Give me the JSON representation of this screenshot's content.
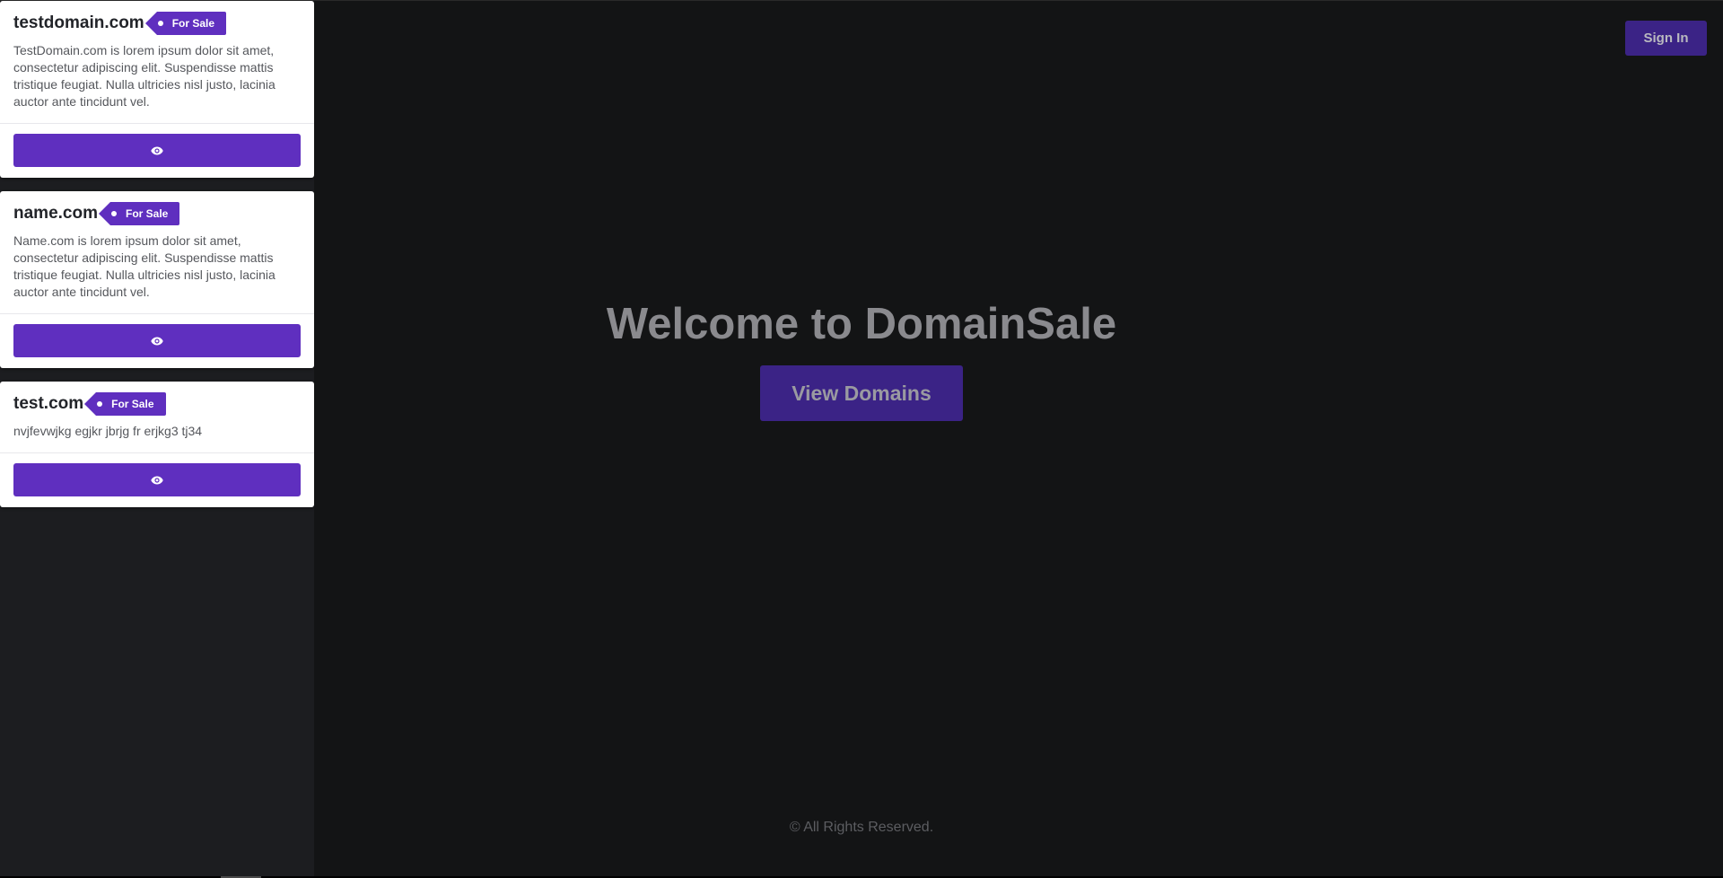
{
  "domains": [
    {
      "name": "testdomain.com",
      "tag": "For Sale",
      "description": "TestDomain.com is lorem ipsum dolor sit amet, consectetur adipiscing elit. Suspendisse mattis tristique feugiat. Nulla ultricies nisl justo, lacinia auctor ante tincidunt vel."
    },
    {
      "name": "name.com",
      "tag": "For Sale",
      "description": "Name.com is lorem ipsum dolor sit amet, consectetur adipiscing elit. Suspendisse mattis tristique feugiat. Nulla ultricies nisl justo, lacinia auctor ante tincidunt vel."
    },
    {
      "name": "test.com",
      "tag": "For Sale",
      "description": "nvjfevwjkg egjkr jbrjg fr erjkg3 tj34"
    }
  ],
  "card_button_icon": "eye-icon",
  "header": {
    "signin_label": "Sign In"
  },
  "hero": {
    "title": "Welcome to DomainSale",
    "button_label": "View Domains"
  },
  "footer": {
    "text": "© All Rights Reserved."
  },
  "colors": {
    "accent": "#5f2fbf",
    "accent_dark": "#3b2386",
    "background": "#131415",
    "sidebar_background": "#1c1d20"
  }
}
